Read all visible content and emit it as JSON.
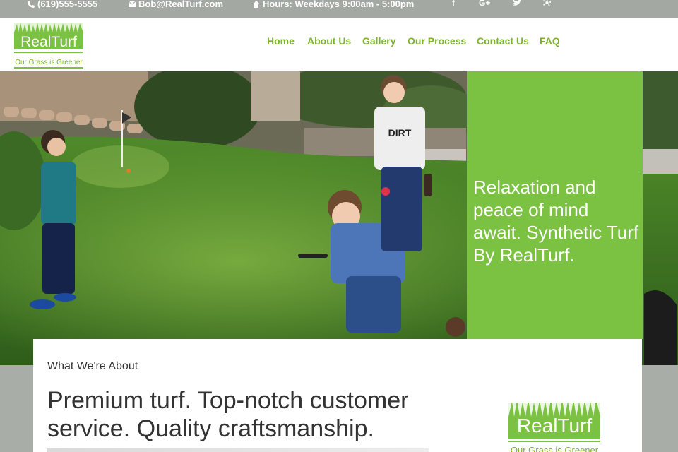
{
  "topbar": {
    "phone": "(619)555-5555",
    "email": "Bob@RealTurf.com",
    "hours": "Hours: Weekdays 9:00am - 5:00pm",
    "social": [
      "f",
      "G+",
      "t",
      "y"
    ]
  },
  "brand": {
    "name": "RealTurf",
    "tagline": "Our Grass is Greener"
  },
  "nav": {
    "items": [
      "Home",
      "About Us",
      "Gallery",
      "Our Process",
      "Contact Us",
      "FAQ"
    ]
  },
  "hero": {
    "callout": "Relaxation and peace of mind await. Synthetic Turf By RealTurf."
  },
  "about": {
    "eyebrow": "What We're About",
    "headline": "Premium turf. Top-notch customer service. Quality craftsmanship."
  },
  "colors": {
    "accent": "#7cc242",
    "nav_text": "#7cb32e",
    "topbar": "#a4a8a2"
  }
}
